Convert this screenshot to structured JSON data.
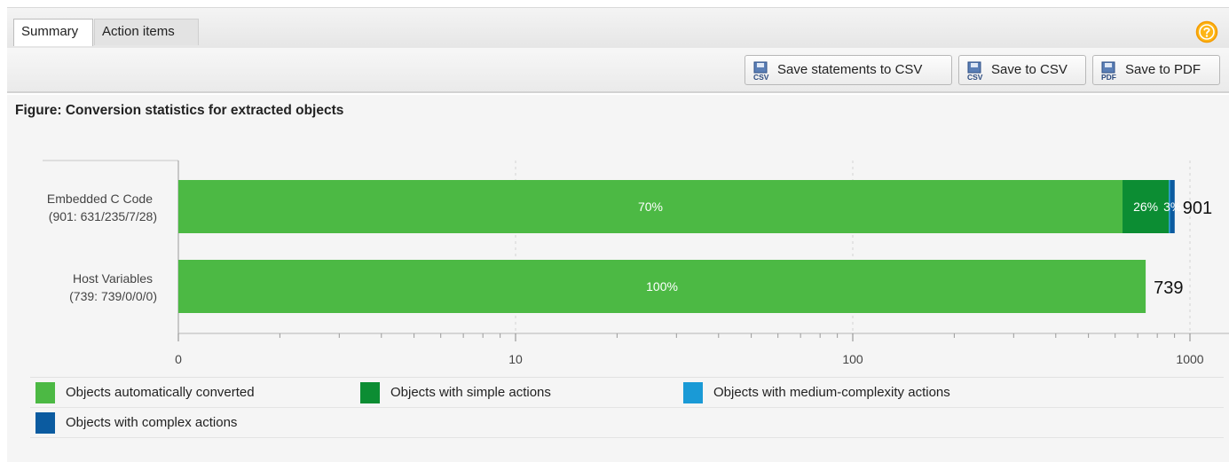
{
  "tabs": [
    {
      "label": "Summary",
      "active": true
    },
    {
      "label": "Action items",
      "active": false
    }
  ],
  "toolbar": {
    "save_statements_csv": "Save statements to CSV",
    "save_csv": "Save to CSV",
    "save_pdf": "Save to PDF"
  },
  "icons": {
    "help": "help-icon",
    "csv": "csv-file-icon",
    "pdf": "pdf-file-icon"
  },
  "colors": {
    "auto": "#4cb944",
    "simple": "#0c8d33",
    "medium": "#1a9ad6",
    "complex": "#0b5ba0",
    "help": "#f5a800"
  },
  "figure_title": "Figure: Conversion statistics for extracted objects",
  "chart_data": {
    "type": "bar",
    "orientation": "horizontal",
    "stacked": true,
    "x_scale": "log",
    "xlim": [
      1,
      1000
    ],
    "x_ticks": [
      1,
      10,
      100,
      1000
    ],
    "x_tick_labels": [
      "0",
      "10",
      "100",
      "1000"
    ],
    "grid": true,
    "legend_position": "bottom",
    "categories": [
      {
        "line1": "Embedded C Code",
        "line2": "(901: 631/235/7/28)",
        "total": "901"
      },
      {
        "line1": "Host Variables",
        "line2": "(739: 739/0/0/0)",
        "total": "739"
      }
    ],
    "series": [
      {
        "name": "Objects automatically converted",
        "key": "auto",
        "values": [
          631,
          739
        ],
        "labels": [
          "70%",
          "100%"
        ]
      },
      {
        "name": "Objects with simple actions",
        "key": "simple",
        "values": [
          235,
          0
        ],
        "labels": [
          "26%",
          ""
        ]
      },
      {
        "name": "Objects with medium-complexity actions",
        "key": "medium",
        "values": [
          7,
          0
        ],
        "labels": [
          "",
          ""
        ]
      },
      {
        "name": "Objects with complex actions",
        "key": "complex",
        "values": [
          28,
          0
        ],
        "labels": [
          "3%",
          ""
        ]
      }
    ]
  }
}
